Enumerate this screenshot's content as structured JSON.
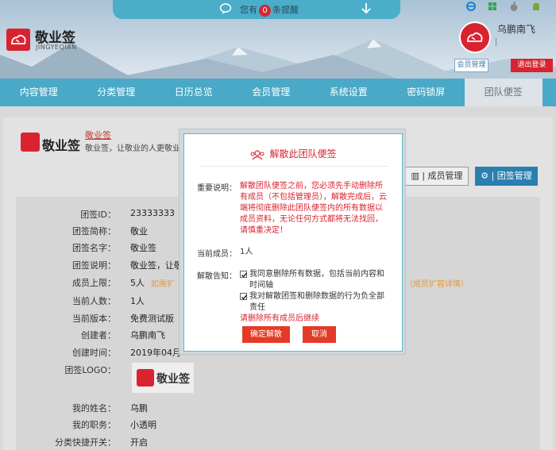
{
  "colors": {
    "brand": "#d9232f",
    "nav": "#49a9c6",
    "modal_border": "#5fb5cf"
  },
  "header": {
    "logo_name": "敬业签",
    "logo_sub": "JINGYEQIAN",
    "notice": {
      "prefix": "您有",
      "count": "0",
      "suffix": "条提醒"
    },
    "platform_icons": [
      "ie-icon",
      "windows-icon",
      "apple-icon",
      "android-icon"
    ],
    "user": {
      "name": "乌鹏南飞",
      "member_label": "会员管理",
      "logout_label": "退出登录"
    }
  },
  "nav": {
    "items": [
      "内容管理",
      "分类管理",
      "日历总览",
      "会员管理",
      "系统设置",
      "密码锁屏",
      "团队便签"
    ],
    "active_index": 6
  },
  "brand": {
    "name": "敬业签",
    "link": "敬业签",
    "desc": "敬业签，让敬业的人更敬业"
  },
  "actions": {
    "members_label": "成员管理",
    "team_label": "团签管理"
  },
  "info": {
    "rows": [
      {
        "label": "团签ID：",
        "value": "23333333"
      },
      {
        "label": "团签简称：",
        "value": "敬业"
      },
      {
        "label": "团签名字：",
        "value": "敬业签"
      },
      {
        "label": "团签说明：",
        "value": "敬业签，让敬"
      },
      {
        "label": "成员上限：",
        "value": "5人"
      },
      {
        "label": "当前人数：",
        "value": "1人"
      },
      {
        "label": "当前版本：",
        "value": "免费测试版"
      },
      {
        "label": "创建者：",
        "value": "乌鹏南飞"
      },
      {
        "label": "创建时间：",
        "value": "2019年04月"
      },
      {
        "label": "团签LOGO：",
        "value": ""
      },
      {
        "label": "我的姓名：",
        "value": "乌鹏"
      },
      {
        "label": "我的职务：",
        "value": "小透明"
      },
      {
        "label": "分类快捷开关：",
        "value": "开启"
      }
    ],
    "expand_hint_left": "如需扩",
    "expand_hint_right": "（成员扩容详情）",
    "logo_preview_text": "敬业签"
  },
  "modal": {
    "title": "解散此团队便签",
    "important_label": "重要说明：",
    "important_text": "解散团队便签之前，您必须先手动删除所有成员（不包括管理员），解散完成后，云端将彻底删除此团队便签内的所有数据以成员资料，无论任何方式都将无法找回，请慎重决定！",
    "current_members_label": "当前成员：",
    "current_members_value": "1人",
    "notice_label": "解散告知：",
    "checks": [
      {
        "text": "我同意删除所有数据，包括当前内容和时间轴",
        "checked": true
      },
      {
        "text": "我对解散团签和删除数据的行为负全部责任",
        "checked": true
      }
    ],
    "warning": "请删除所有成员后继续",
    "confirm_label": "确定解散",
    "cancel_label": "取消"
  }
}
